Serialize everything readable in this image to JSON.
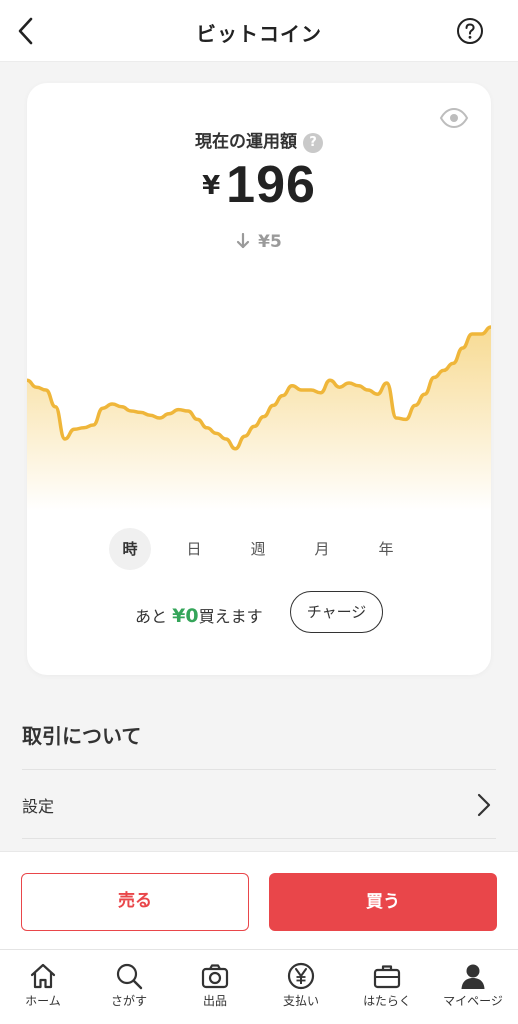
{
  "header": {
    "title": "ビットコイン"
  },
  "card": {
    "label": "現在の運用額",
    "help_badge": "?",
    "currency": "¥",
    "amount": "196",
    "change": "¥5",
    "periods": [
      "時",
      "日",
      "週",
      "月",
      "年"
    ],
    "active_period": "時",
    "buyable_prefix": "あと",
    "buyable_amount": "¥0",
    "buyable_suffix": "買えます",
    "charge_label": "チャージ"
  },
  "chart_data": {
    "type": "area",
    "y": [
      62,
      57,
      55,
      43,
      20,
      27,
      28,
      30,
      42,
      45,
      43,
      40,
      39,
      37,
      35,
      38,
      41,
      40,
      34,
      28,
      24,
      20,
      13,
      22,
      29,
      36,
      44,
      51,
      58,
      55,
      55,
      53,
      62,
      57,
      60,
      58,
      55,
      52,
      60,
      35,
      34,
      44,
      52,
      64,
      69,
      74,
      85,
      95,
      95,
      100
    ],
    "color": "#efb63a",
    "fill_top": "#f7d98e"
  },
  "transactions": {
    "title": "取引について",
    "settings_label": "設定"
  },
  "actions": {
    "sell": "売る",
    "buy": "買う"
  },
  "tabbar": {
    "items": [
      {
        "label": "ホーム",
        "icon": "home-icon"
      },
      {
        "label": "さがす",
        "icon": "search-icon"
      },
      {
        "label": "出品",
        "icon": "camera-icon"
      },
      {
        "label": "支払い",
        "icon": "yen-coin-icon"
      },
      {
        "label": "はたらく",
        "icon": "briefcase-icon"
      },
      {
        "label": "マイページ",
        "icon": "person-icon"
      }
    ]
  },
  "colors": {
    "accent_red": "#e9464a",
    "green": "#35a55a"
  }
}
